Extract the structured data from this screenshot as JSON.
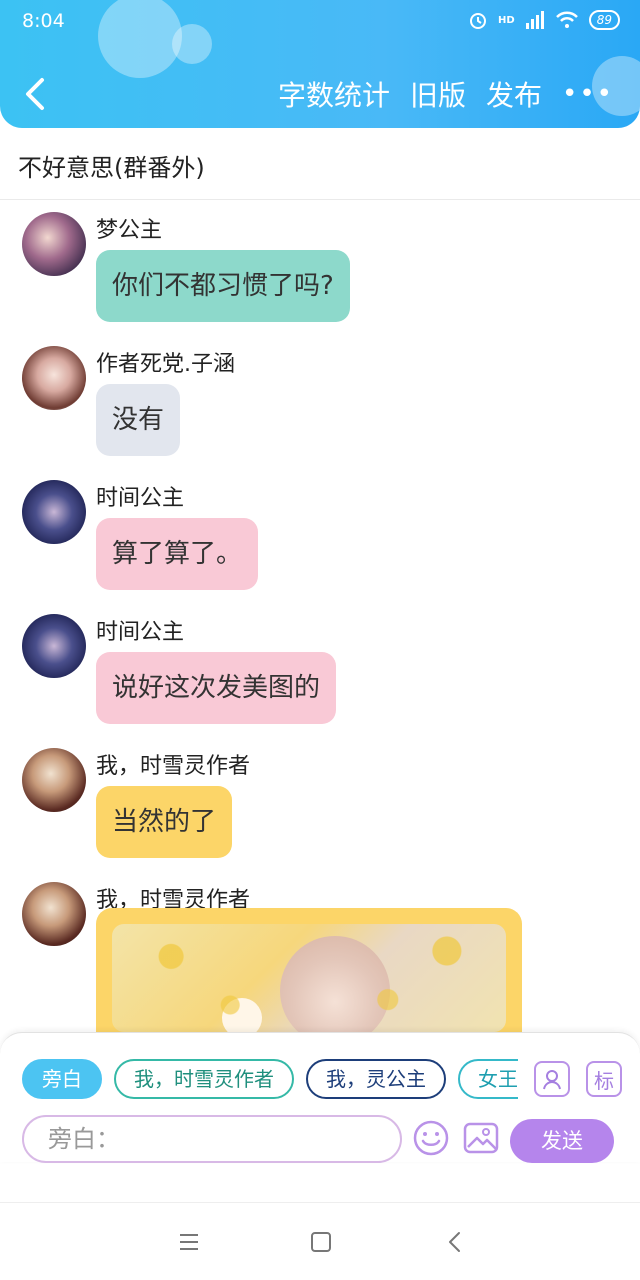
{
  "status_bar": {
    "time": "8:04",
    "network": "HD",
    "battery": "89"
  },
  "header": {
    "actions": [
      "字数统计",
      "旧版",
      "发布"
    ],
    "more": "•••"
  },
  "story": {
    "title": "不好意思(群番外)"
  },
  "messages": [
    {
      "sender": "梦公主",
      "text": "你们不都习惯了吗?",
      "color": "#8dd9cb"
    },
    {
      "sender": "作者死党.子涵",
      "text": "没有",
      "color": "#e2e6ee"
    },
    {
      "sender": "时间公主",
      "text": "算了算了。",
      "color": "#f9c9d6"
    },
    {
      "sender": "时间公主",
      "text": "说好这次发美图的",
      "color": "#f9c9d6"
    },
    {
      "sender": "我，时雪灵作者",
      "text": "当然的了",
      "color": "#fcd568"
    },
    {
      "sender": "我，时雪灵作者",
      "text": "",
      "color": "#fcd568"
    }
  ],
  "composer": {
    "roles": [
      "旁白",
      "我，时雪灵作者",
      "我，灵公主",
      "女王"
    ],
    "tag_icon": "标",
    "placeholder": "旁白：",
    "send_label": "发送"
  }
}
